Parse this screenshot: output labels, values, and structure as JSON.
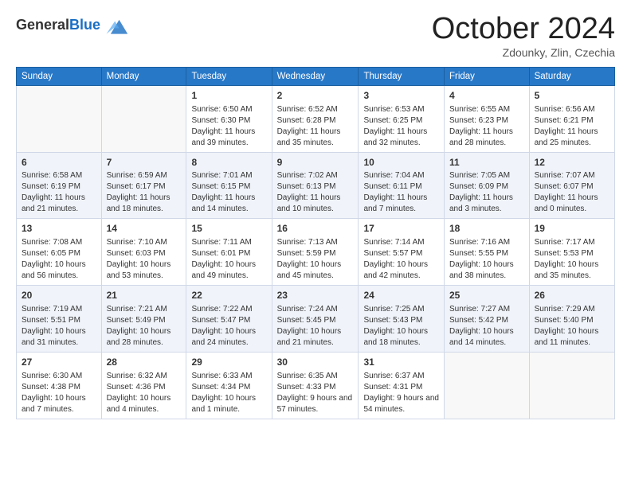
{
  "header": {
    "logo_general": "General",
    "logo_blue": "Blue",
    "month_title": "October 2024",
    "location": "Zdounky, Zlin, Czechia"
  },
  "days_of_week": [
    "Sunday",
    "Monday",
    "Tuesday",
    "Wednesday",
    "Thursday",
    "Friday",
    "Saturday"
  ],
  "weeks": [
    [
      {
        "day": "",
        "content": ""
      },
      {
        "day": "",
        "content": ""
      },
      {
        "day": "1",
        "content": "Sunrise: 6:50 AM\nSunset: 6:30 PM\nDaylight: 11 hours and 39 minutes."
      },
      {
        "day": "2",
        "content": "Sunrise: 6:52 AM\nSunset: 6:28 PM\nDaylight: 11 hours and 35 minutes."
      },
      {
        "day": "3",
        "content": "Sunrise: 6:53 AM\nSunset: 6:25 PM\nDaylight: 11 hours and 32 minutes."
      },
      {
        "day": "4",
        "content": "Sunrise: 6:55 AM\nSunset: 6:23 PM\nDaylight: 11 hours and 28 minutes."
      },
      {
        "day": "5",
        "content": "Sunrise: 6:56 AM\nSunset: 6:21 PM\nDaylight: 11 hours and 25 minutes."
      }
    ],
    [
      {
        "day": "6",
        "content": "Sunrise: 6:58 AM\nSunset: 6:19 PM\nDaylight: 11 hours and 21 minutes."
      },
      {
        "day": "7",
        "content": "Sunrise: 6:59 AM\nSunset: 6:17 PM\nDaylight: 11 hours and 18 minutes."
      },
      {
        "day": "8",
        "content": "Sunrise: 7:01 AM\nSunset: 6:15 PM\nDaylight: 11 hours and 14 minutes."
      },
      {
        "day": "9",
        "content": "Sunrise: 7:02 AM\nSunset: 6:13 PM\nDaylight: 11 hours and 10 minutes."
      },
      {
        "day": "10",
        "content": "Sunrise: 7:04 AM\nSunset: 6:11 PM\nDaylight: 11 hours and 7 minutes."
      },
      {
        "day": "11",
        "content": "Sunrise: 7:05 AM\nSunset: 6:09 PM\nDaylight: 11 hours and 3 minutes."
      },
      {
        "day": "12",
        "content": "Sunrise: 7:07 AM\nSunset: 6:07 PM\nDaylight: 11 hours and 0 minutes."
      }
    ],
    [
      {
        "day": "13",
        "content": "Sunrise: 7:08 AM\nSunset: 6:05 PM\nDaylight: 10 hours and 56 minutes."
      },
      {
        "day": "14",
        "content": "Sunrise: 7:10 AM\nSunset: 6:03 PM\nDaylight: 10 hours and 53 minutes."
      },
      {
        "day": "15",
        "content": "Sunrise: 7:11 AM\nSunset: 6:01 PM\nDaylight: 10 hours and 49 minutes."
      },
      {
        "day": "16",
        "content": "Sunrise: 7:13 AM\nSunset: 5:59 PM\nDaylight: 10 hours and 45 minutes."
      },
      {
        "day": "17",
        "content": "Sunrise: 7:14 AM\nSunset: 5:57 PM\nDaylight: 10 hours and 42 minutes."
      },
      {
        "day": "18",
        "content": "Sunrise: 7:16 AM\nSunset: 5:55 PM\nDaylight: 10 hours and 38 minutes."
      },
      {
        "day": "19",
        "content": "Sunrise: 7:17 AM\nSunset: 5:53 PM\nDaylight: 10 hours and 35 minutes."
      }
    ],
    [
      {
        "day": "20",
        "content": "Sunrise: 7:19 AM\nSunset: 5:51 PM\nDaylight: 10 hours and 31 minutes."
      },
      {
        "day": "21",
        "content": "Sunrise: 7:21 AM\nSunset: 5:49 PM\nDaylight: 10 hours and 28 minutes."
      },
      {
        "day": "22",
        "content": "Sunrise: 7:22 AM\nSunset: 5:47 PM\nDaylight: 10 hours and 24 minutes."
      },
      {
        "day": "23",
        "content": "Sunrise: 7:24 AM\nSunset: 5:45 PM\nDaylight: 10 hours and 21 minutes."
      },
      {
        "day": "24",
        "content": "Sunrise: 7:25 AM\nSunset: 5:43 PM\nDaylight: 10 hours and 18 minutes."
      },
      {
        "day": "25",
        "content": "Sunrise: 7:27 AM\nSunset: 5:42 PM\nDaylight: 10 hours and 14 minutes."
      },
      {
        "day": "26",
        "content": "Sunrise: 7:29 AM\nSunset: 5:40 PM\nDaylight: 10 hours and 11 minutes."
      }
    ],
    [
      {
        "day": "27",
        "content": "Sunrise: 6:30 AM\nSunset: 4:38 PM\nDaylight: 10 hours and 7 minutes."
      },
      {
        "day": "28",
        "content": "Sunrise: 6:32 AM\nSunset: 4:36 PM\nDaylight: 10 hours and 4 minutes."
      },
      {
        "day": "29",
        "content": "Sunrise: 6:33 AM\nSunset: 4:34 PM\nDaylight: 10 hours and 1 minute."
      },
      {
        "day": "30",
        "content": "Sunrise: 6:35 AM\nSunset: 4:33 PM\nDaylight: 9 hours and 57 minutes."
      },
      {
        "day": "31",
        "content": "Sunrise: 6:37 AM\nSunset: 4:31 PM\nDaylight: 9 hours and 54 minutes."
      },
      {
        "day": "",
        "content": ""
      },
      {
        "day": "",
        "content": ""
      }
    ]
  ]
}
